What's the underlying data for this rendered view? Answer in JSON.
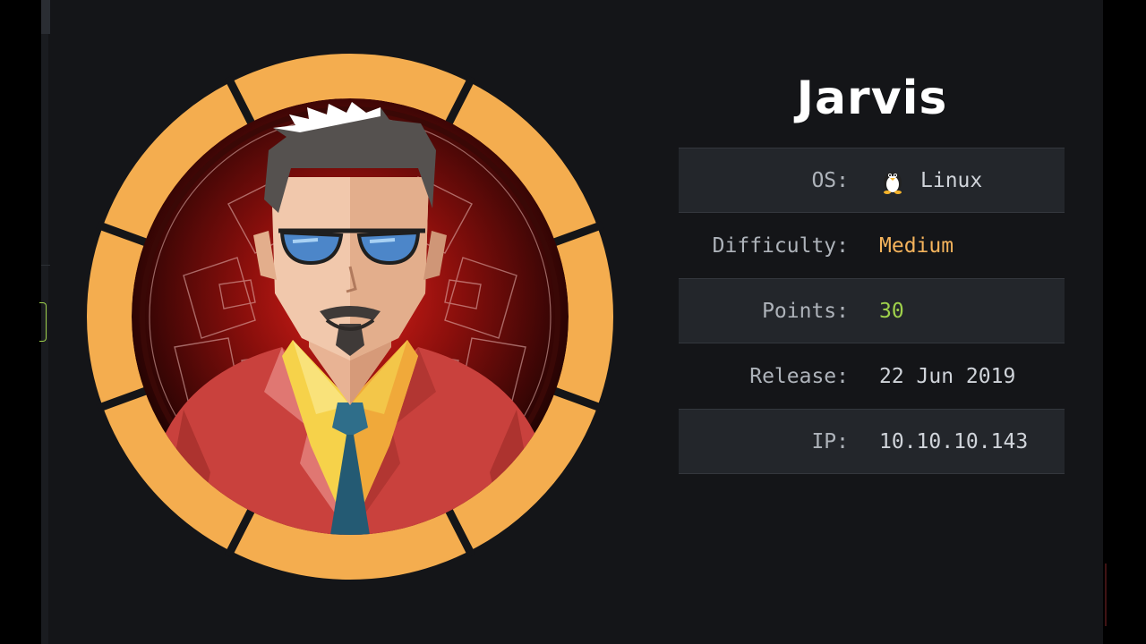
{
  "machine": {
    "name": "Jarvis"
  },
  "info": {
    "os_label": "OS:",
    "os_value": "Linux",
    "os_icon": "linux-penguin-icon",
    "difficulty_label": "Difficulty:",
    "difficulty_value": "Medium",
    "points_label": "Points:",
    "points_value": "30",
    "release_label": "Release:",
    "release_value": "22 Jun 2019",
    "ip_label": "IP:",
    "ip_value": "10.10.10.143"
  },
  "colors": {
    "background": "#141518",
    "difficulty_medium": "#f4b35c",
    "points": "#9fd14b",
    "badge_ring": "#f4ad4f",
    "row_shade": "#23262b"
  }
}
